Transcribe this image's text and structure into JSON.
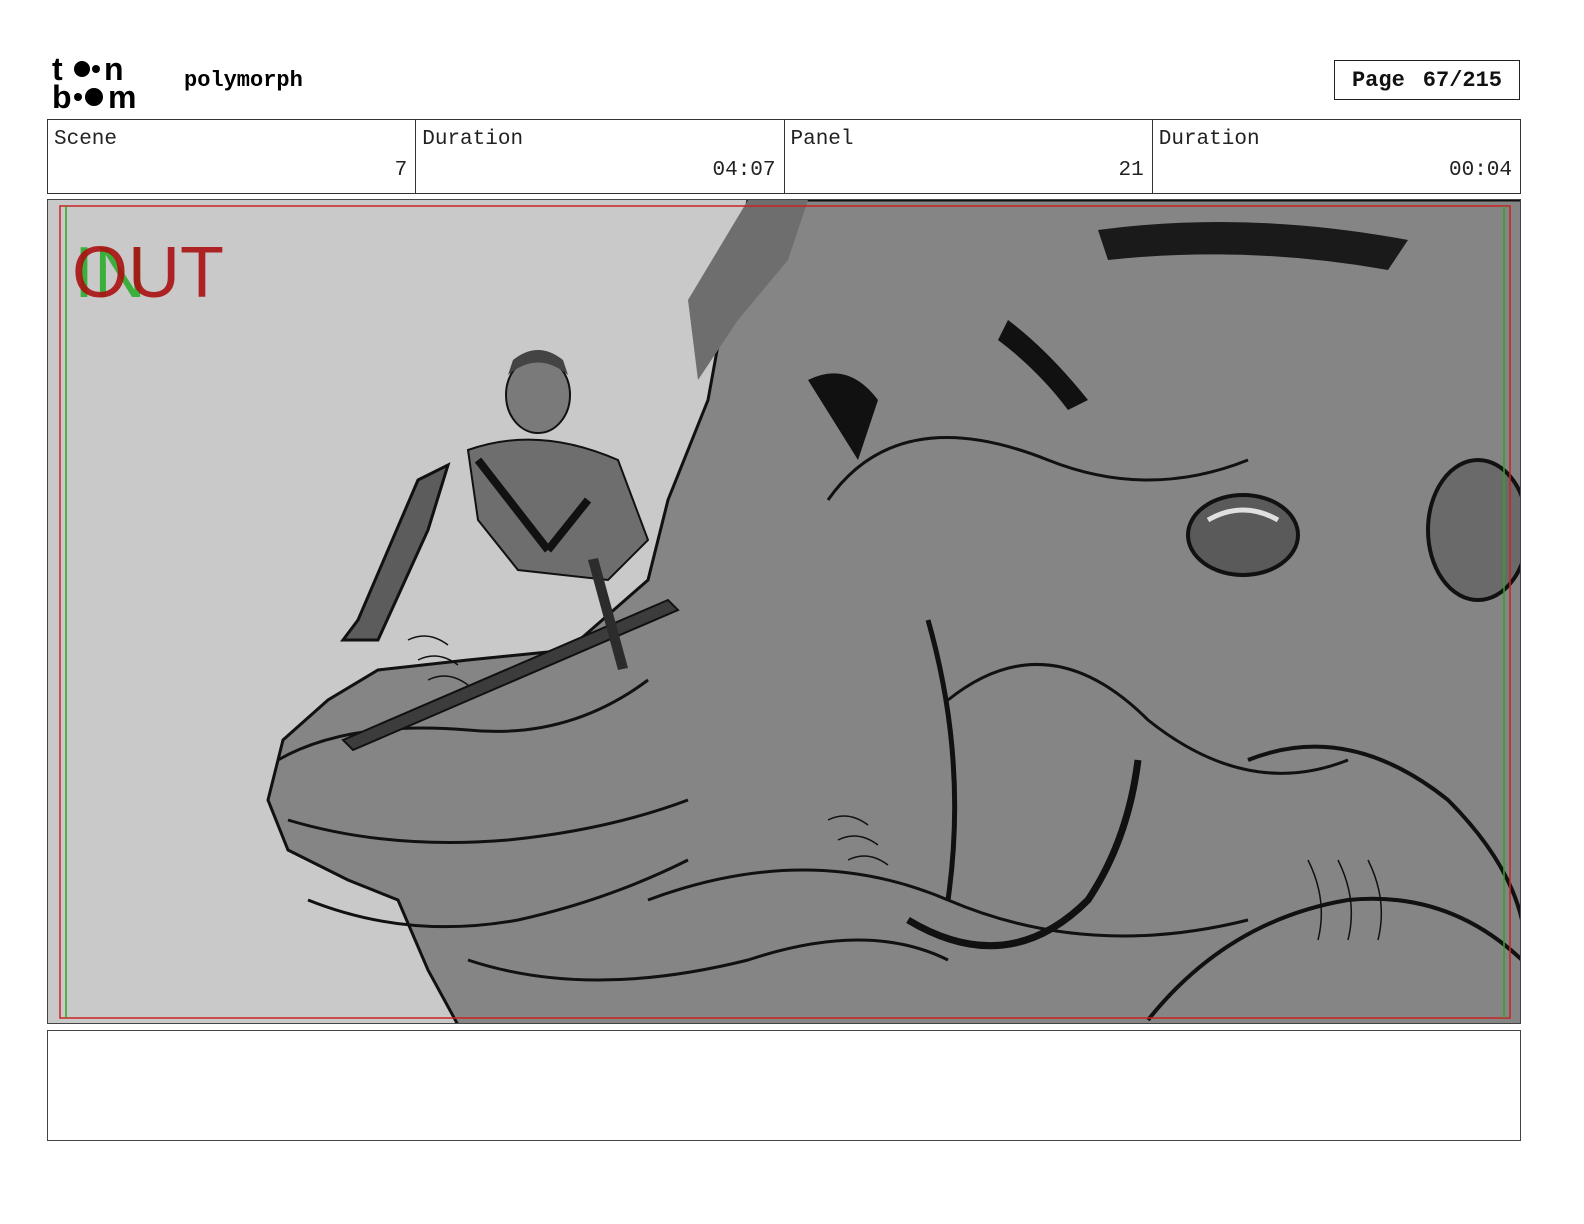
{
  "header": {
    "logo_text": "toon boom",
    "project_title": "polymorph",
    "page_label": "Page",
    "page_number": "67/215"
  },
  "info": {
    "scene_label": "Scene",
    "scene_value": "7",
    "scene_duration_label": "Duration",
    "scene_duration_value": "04:07",
    "panel_label": "Panel",
    "panel_value": "21",
    "panel_duration_label": "Duration",
    "panel_duration_value": "00:04"
  },
  "panel": {
    "in_marker": "IN",
    "out_marker": "OUT",
    "in_color": "#22aa22",
    "out_color": "#aa1111",
    "safe_frame_color": "#cc2222"
  },
  "notes": {
    "text": ""
  }
}
